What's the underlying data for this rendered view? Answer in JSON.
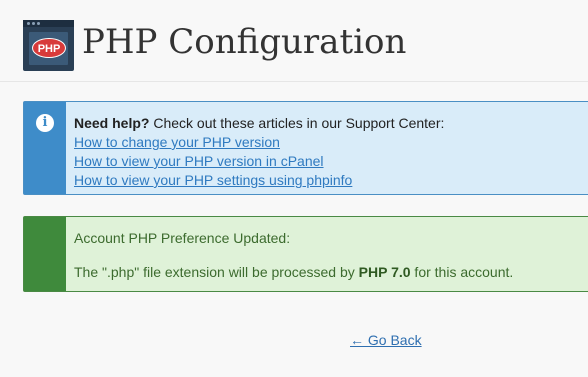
{
  "header": {
    "logo_text": "PHP",
    "title": "PHP Configuration",
    "icon": "php-logo-icon"
  },
  "info": {
    "icon": "info-icon",
    "icon_glyph": "i",
    "need_help": "Need help?",
    "intro": " Check out these articles in our Support Center:",
    "links": [
      "How to change your PHP version",
      "How to view your PHP version in cPanel",
      "How to view your PHP settings using phpinfo"
    ],
    "colors": {
      "strip": "#3e8cc9",
      "background": "#d9ecf9",
      "link": "#2f7ac0"
    }
  },
  "success": {
    "title": "Account PHP Preference Updated:",
    "message_prefix": "The \".php\" file extension will be processed by ",
    "php_version": "PHP 7.0",
    "message_suffix": " for this account.",
    "colors": {
      "strip": "#3f8a3c",
      "background": "#dff2d8",
      "text": "#3c6b2e"
    }
  },
  "nav": {
    "go_back": "← Go Back"
  }
}
